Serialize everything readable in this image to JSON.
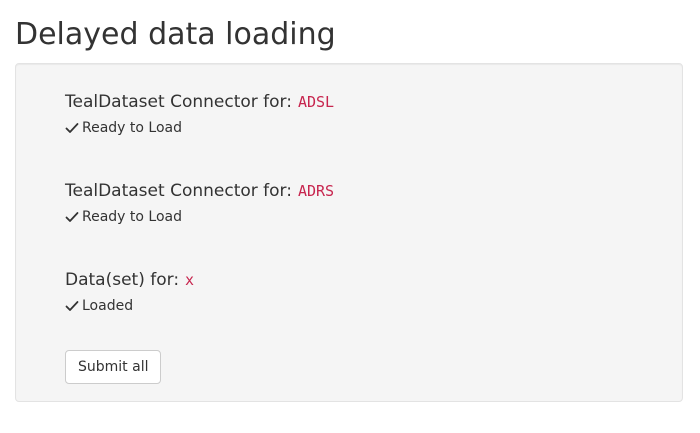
{
  "page": {
    "title": "Delayed data loading"
  },
  "entries": [
    {
      "label": "TealDataset Connector for:",
      "code": "ADSL",
      "status": "Ready to Load",
      "status_icon": "check-icon"
    },
    {
      "label": "TealDataset Connector for:",
      "code": "ADRS",
      "status": "Ready to Load",
      "status_icon": "check-icon"
    },
    {
      "label": "Data(set) for:",
      "code": "x",
      "status": "Loaded",
      "status_icon": "check-icon"
    }
  ],
  "actions": {
    "submit_label": "Submit all"
  },
  "colors": {
    "code_text": "#c7254e",
    "well_background": "#f5f5f5",
    "text": "#333333"
  }
}
